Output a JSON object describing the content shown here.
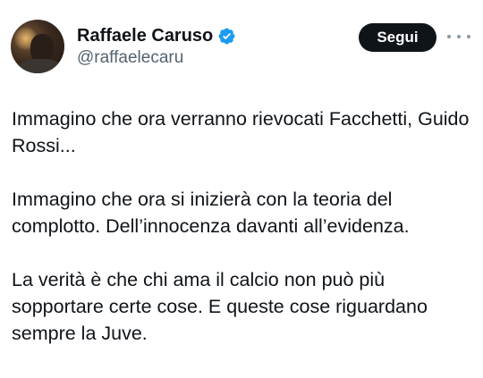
{
  "author": {
    "display_name": "Raffaele Caruso",
    "handle": "@raffaelecaru",
    "verified_icon": "verified-badge-icon",
    "badge_color": "#1d9bf0"
  },
  "actions": {
    "follow_label": "Segui",
    "more_icon": "more-options-icon"
  },
  "tweet": {
    "paragraphs": [
      "Immagino che ora verranno rievocati Facchetti, Guido Rossi...",
      "Immagino che ora si inizierà con la teoria del complotto. Dell’innocenza davanti all’evidenza.",
      "La verità è che chi ama il calcio non può più sopportare certe cose. E queste cose riguardano sempre la Juve."
    ]
  }
}
